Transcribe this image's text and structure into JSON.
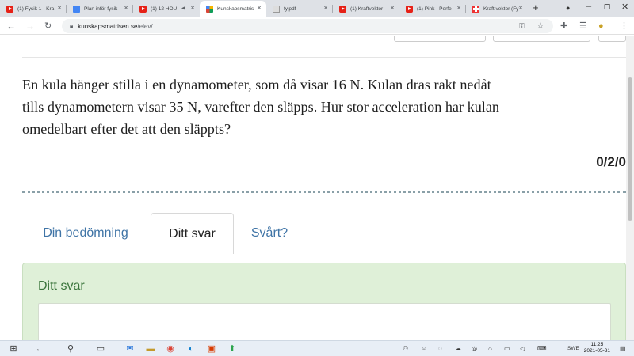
{
  "browser": {
    "tabs": [
      {
        "title": "(1) Fysik 1 - Kra",
        "icon": "youtube-icon"
      },
      {
        "title": "Plan inför fysik",
        "icon": "google-docs-icon"
      },
      {
        "title": "(1) 12 HOU",
        "icon": "youtube-icon"
      },
      {
        "title": "Kunskapsmatris",
        "icon": "kunskapsmatrisen-icon"
      },
      {
        "title": "fy.pdf",
        "icon": "pdf-icon"
      },
      {
        "title": "(1) Kraftvektor",
        "icon": "youtube-icon"
      },
      {
        "title": "(1) Pink - Perfe",
        "icon": "youtube-icon"
      },
      {
        "title": "Kraft vektor (Fy",
        "icon": "red-cross-icon"
      }
    ],
    "new_tab": "+",
    "url_host": "kunskapsmatrisen.se",
    "url_path": "/elev/"
  },
  "question": {
    "text": "En kula hänger stilla i en dynamometer, som då visar 16 N. Kulan dras rakt nedåt tills dynamometern visar 35 N, varefter den släpps. Hur stor acceleration har kulan omedelbart efter det att den släppts?",
    "score": "0/2/0"
  },
  "tabs": [
    {
      "label": "Din bedömning",
      "active": false
    },
    {
      "label": "Ditt svar",
      "active": true
    },
    {
      "label": "Svårt?",
      "active": false
    }
  ],
  "panel": {
    "title": "Ditt svar",
    "answer_value": ""
  },
  "taskbar": {
    "language": "SWE",
    "time": "11:25",
    "date": "2021-05-31"
  },
  "colors": {
    "tab_link": "#3f74a6",
    "panel_bg": "#dff0d8",
    "panel_title": "#3c763d"
  }
}
